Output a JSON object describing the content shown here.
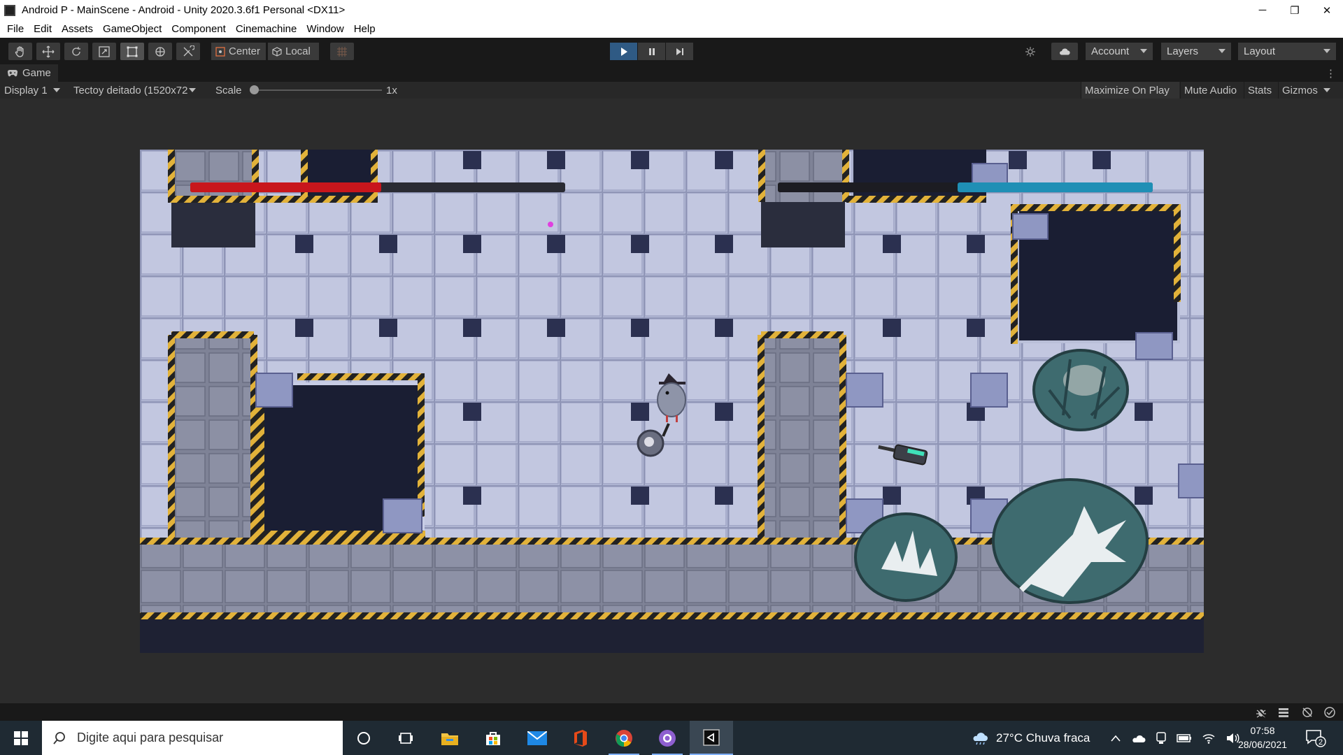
{
  "window": {
    "title": "Android P - MainScene - Android - Unity 2020.3.6f1 Personal <DX11>",
    "minimize": "─",
    "restore": "❐",
    "close": "✕"
  },
  "menu": {
    "items": [
      "File",
      "Edit",
      "Assets",
      "GameObject",
      "Component",
      "Cinemachine",
      "Window",
      "Help"
    ]
  },
  "toolbar": {
    "pivot_label": "Center",
    "space_label": "Local",
    "account_label": "Account",
    "layers_label": "Layers",
    "layout_label": "Layout"
  },
  "game_tab": {
    "label": "Game",
    "display": "Display 1",
    "resolution": "Tectoy deitado (1520x72",
    "scale_label": "Scale",
    "scale_value": "1x",
    "maximize_on_play": "Maximize On Play",
    "mute_audio": "Mute Audio",
    "stats": "Stats",
    "gizmos": "Gizmos"
  },
  "game": {
    "player1_health_fraction": 0.51,
    "player2_health_fraction": 0.52,
    "player1_color": "#c8161c",
    "player2_color": "#1f8fb5"
  },
  "taskbar": {
    "search_placeholder": "Digite aqui para pesquisar",
    "weather": "27°C  Chuva fraca",
    "time": "07:58",
    "date": "28/06/2021",
    "notifications": "2",
    "apps": [
      "cortana-icon",
      "task-view-icon",
      "file-explorer-icon",
      "store-icon",
      "mail-icon",
      "office-icon",
      "chrome-icon",
      "github-desktop-icon",
      "unity-icon"
    ]
  }
}
